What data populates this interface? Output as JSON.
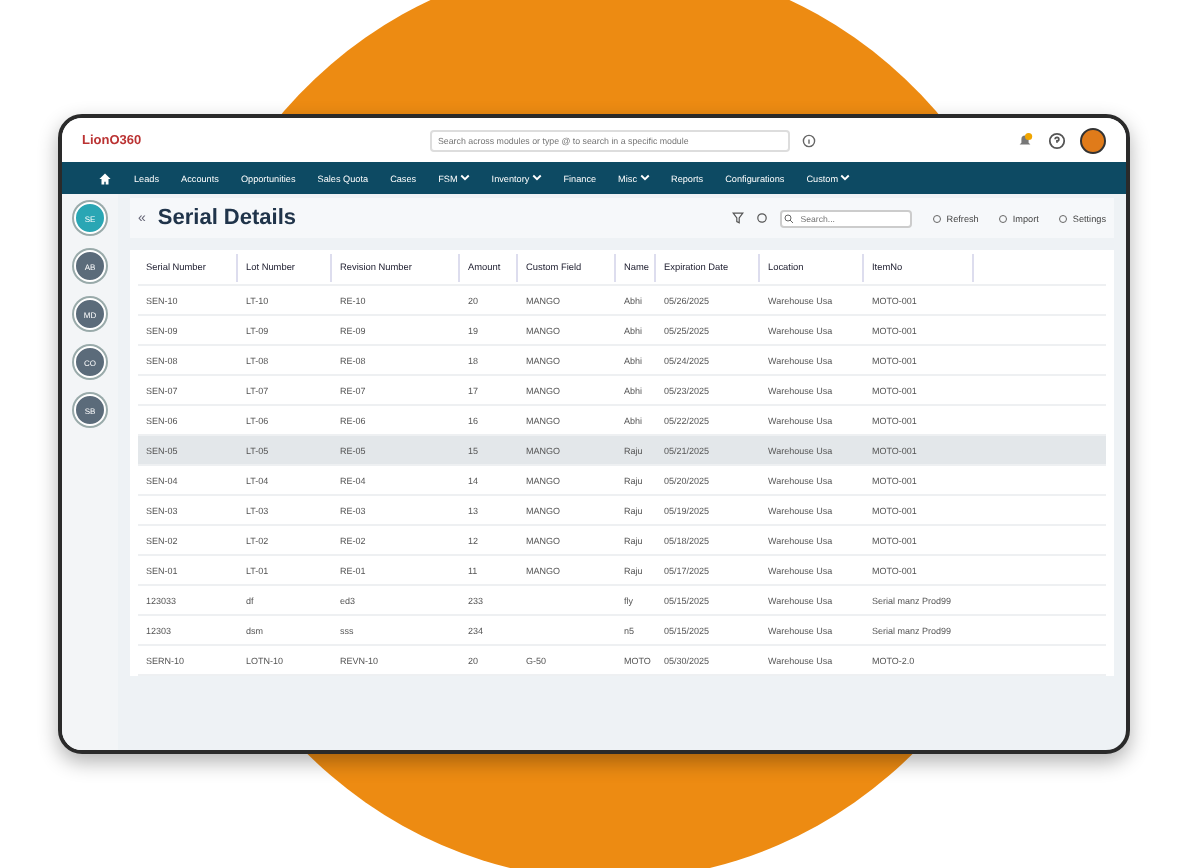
{
  "header": {
    "logo": "LionO360",
    "search": {
      "placeholder": "Search across modules or type @ to search in a specific module"
    }
  },
  "nav": [
    {
      "label": "Leads",
      "dropdown": false
    },
    {
      "label": "Accounts",
      "dropdown": false
    },
    {
      "label": "Opportunities",
      "dropdown": false
    },
    {
      "label": "Sales Quota",
      "dropdown": false
    },
    {
      "label": "Cases",
      "dropdown": false
    },
    {
      "label": "FSM",
      "dropdown": true
    },
    {
      "label": "Inventory",
      "dropdown": true
    },
    {
      "label": "Finance",
      "dropdown": false
    },
    {
      "label": "Misc",
      "dropdown": true
    },
    {
      "label": "Reports",
      "dropdown": false
    },
    {
      "label": "Configurations",
      "dropdown": false
    },
    {
      "label": "Custom",
      "dropdown": true
    }
  ],
  "rail": [
    {
      "label": "SE",
      "selected": true
    },
    {
      "label": "AB",
      "selected": false
    },
    {
      "label": "MD",
      "selected": false
    },
    {
      "label": "CO",
      "selected": false
    },
    {
      "label": "SB",
      "selected": false
    }
  ],
  "page": {
    "collapse": "«",
    "title": "Serial Details",
    "search": {
      "placeholder": "Search..."
    },
    "actions": [
      "Refresh",
      "Import",
      "Settings"
    ]
  },
  "table": {
    "columns": [
      "Serial Number",
      "Lot Number",
      "Revision Number",
      "Amount",
      "Custom Field",
      "Name",
      "Expiration Date",
      "Location",
      "ItemNo"
    ],
    "rows": [
      {
        "cells": [
          "SEN-10",
          "LT-10",
          "RE-10",
          "20",
          "MANGO",
          "Abhi",
          "05/26/2025",
          "Warehouse Usa",
          "MOTO-001"
        ],
        "selected": false
      },
      {
        "cells": [
          "SEN-09",
          "LT-09",
          "RE-09",
          "19",
          "MANGO",
          "Abhi",
          "05/25/2025",
          "Warehouse Usa",
          "MOTO-001"
        ],
        "selected": false
      },
      {
        "cells": [
          "SEN-08",
          "LT-08",
          "RE-08",
          "18",
          "MANGO",
          "Abhi",
          "05/24/2025",
          "Warehouse Usa",
          "MOTO-001"
        ],
        "selected": false
      },
      {
        "cells": [
          "SEN-07",
          "LT-07",
          "RE-07",
          "17",
          "MANGO",
          "Abhi",
          "05/23/2025",
          "Warehouse Usa",
          "MOTO-001"
        ],
        "selected": false
      },
      {
        "cells": [
          "SEN-06",
          "LT-06",
          "RE-06",
          "16",
          "MANGO",
          "Abhi",
          "05/22/2025",
          "Warehouse Usa",
          "MOTO-001"
        ],
        "selected": false
      },
      {
        "cells": [
          "SEN-05",
          "LT-05",
          "RE-05",
          "15",
          "MANGO",
          "Raju",
          "05/21/2025",
          "Warehouse Usa",
          "MOTO-001"
        ],
        "selected": true
      },
      {
        "cells": [
          "SEN-04",
          "LT-04",
          "RE-04",
          "14",
          "MANGO",
          "Raju",
          "05/20/2025",
          "Warehouse Usa",
          "MOTO-001"
        ],
        "selected": false
      },
      {
        "cells": [
          "SEN-03",
          "LT-03",
          "RE-03",
          "13",
          "MANGO",
          "Raju",
          "05/19/2025",
          "Warehouse Usa",
          "MOTO-001"
        ],
        "selected": false
      },
      {
        "cells": [
          "SEN-02",
          "LT-02",
          "RE-02",
          "12",
          "MANGO",
          "Raju",
          "05/18/2025",
          "Warehouse Usa",
          "MOTO-001"
        ],
        "selected": false
      },
      {
        "cells": [
          "SEN-01",
          "LT-01",
          "RE-01",
          "11",
          "MANGO",
          "Raju",
          "05/17/2025",
          "Warehouse Usa",
          "MOTO-001"
        ],
        "selected": false
      },
      {
        "cells": [
          "123033",
          "df",
          "ed3",
          "233",
          "",
          "fly",
          "05/15/2025",
          "Warehouse Usa",
          "Serial manz Prod99"
        ],
        "selected": false
      },
      {
        "cells": [
          "12303",
          "dsm",
          "sss",
          "234",
          "",
          "n5",
          "05/15/2025",
          "Warehouse Usa",
          "Serial manz Prod99"
        ],
        "selected": false
      },
      {
        "cells": [
          "SERN-10",
          "LOTN-10",
          "REVN-10",
          "20",
          "G-50",
          "MOTO",
          "05/30/2025",
          "Warehouse Usa",
          "MOTO-2.0"
        ],
        "selected": false
      }
    ]
  }
}
